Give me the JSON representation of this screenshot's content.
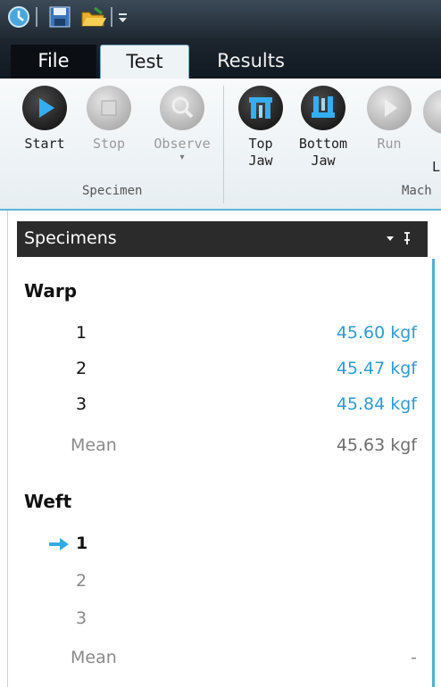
{
  "tabs": {
    "file": "File",
    "test": "Test",
    "results": "Results"
  },
  "ribbon": {
    "buttons": [
      {
        "label": "Start",
        "icon": "play-icon",
        "enabled": true
      },
      {
        "label": "Stop",
        "icon": "stop-icon",
        "enabled": false
      },
      {
        "label": "Observe",
        "icon": "observe-icon",
        "enabled": false
      },
      {
        "label": "Top\nJaw",
        "icon": "top-jaw-icon",
        "enabled": true
      },
      {
        "label": "Bottom\nJaw",
        "icon": "bottom-jaw-icon",
        "enabled": true
      },
      {
        "label": "Run",
        "icon": "run-icon",
        "enabled": false
      }
    ],
    "groups": {
      "specimen": "Specimen",
      "machine": "Mach"
    },
    "partial_label": "L"
  },
  "panel": {
    "title": "Specimens",
    "header_icons": "▾  ᵖ",
    "warp": {
      "title": "Warp",
      "rows": [
        {
          "num": "1",
          "val": "45.60 kgf"
        },
        {
          "num": "2",
          "val": "45.47 kgf"
        },
        {
          "num": "3",
          "val": "45.84 kgf"
        }
      ],
      "mean_label": "Mean",
      "mean_val": "45.63 kgf"
    },
    "weft": {
      "title": "Weft",
      "rows": [
        {
          "num": "1",
          "current": true
        },
        {
          "num": "2"
        },
        {
          "num": "3"
        }
      ],
      "mean_label": "Mean",
      "mean_val": "-"
    }
  },
  "colors": {
    "accent": "#2f9bd3",
    "header_bg": "#2b2b2b"
  }
}
